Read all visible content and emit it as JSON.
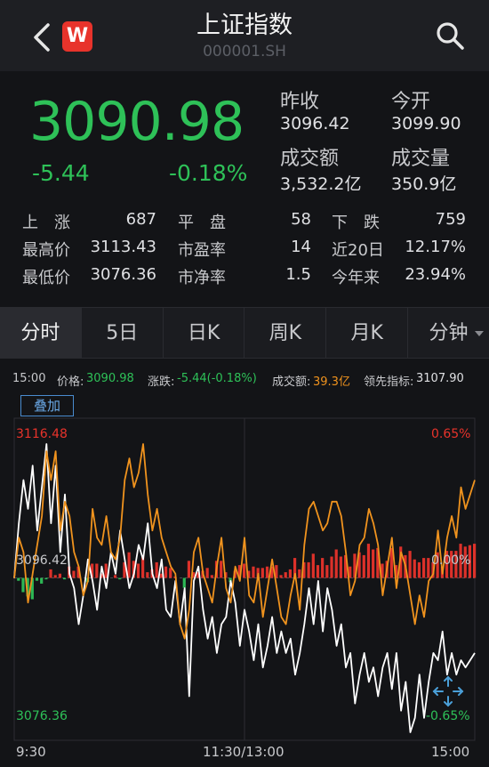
{
  "header": {
    "title": "上证指数",
    "code": "000001.SH",
    "logo_text": "W",
    "back_icon": "chevron-left-icon",
    "search_icon": "search-icon"
  },
  "quote": {
    "price": "3090.98",
    "change": "-5.44",
    "change_pct": "-0.18%",
    "prev_close_label": "昨收",
    "prev_close": "3096.42",
    "open_label": "今开",
    "open": "3099.90",
    "turnover_label": "成交额",
    "turnover": "3,532.2亿",
    "volume_label": "成交量",
    "volume": "350.9亿"
  },
  "stats": {
    "up_label": "上　涨",
    "up": "687",
    "flat_label": "平　盘",
    "flat": "58",
    "down_label": "下　跌",
    "down": "759",
    "high_label": "最高价",
    "high": "3113.43",
    "pe_label": "市盈率",
    "pe": "14",
    "d20_label": "近20日",
    "d20": "12.17%",
    "low_label": "最低价",
    "low": "3076.36",
    "pb_label": "市净率",
    "pb": "1.5",
    "ytd_label": "今年来",
    "ytd": "23.94%"
  },
  "tabs": [
    "分时",
    "5日",
    "日K",
    "周K",
    "月K",
    "分钟"
  ],
  "active_tab": "分时",
  "chart_info": {
    "time": "15:00",
    "price_label": "价格:",
    "price": "3090.98",
    "change_label": "涨跌:",
    "change": "-5.44(-0.18%)",
    "amount_label": "成交额:",
    "amount": "39.3亿",
    "lead_label": "领先指标:",
    "lead": "3107.90"
  },
  "overlay_button": "叠加",
  "colors": {
    "up": "#e8332b",
    "down": "#2ec158",
    "price_line": "#ffffff",
    "lead_line": "#f0931e",
    "accent": "#4a8ccf"
  },
  "chart_data": {
    "type": "line",
    "ylim": [
      3076.36,
      3116.48
    ],
    "pct_labels": [
      "0.65%",
      "0.00%",
      "-0.65%"
    ],
    "y_labels": [
      "3116.48",
      "3096.42",
      "3076.36"
    ],
    "x_labels": [
      "9:30",
      "11:30/13:00",
      "15:00"
    ],
    "series": [
      {
        "color": "white",
        "values": [
          3096.4,
          3104,
          3110,
          3106,
          3112,
          3103,
          3109,
          3115,
          3104,
          3112,
          3100,
          3108,
          3097,
          3095,
          3090,
          3094,
          3099,
          3096,
          3092,
          3098,
          3095,
          3100,
          3097,
          3103,
          3099,
          3095,
          3097,
          3101,
          3099,
          3104,
          3097,
          3095,
          3099,
          3092,
          3091,
          3096,
          3090,
          3095,
          3080,
          3096,
          3098,
          3092,
          3088,
          3091,
          3086,
          3090,
          3091,
          3096,
          3093,
          3087,
          3092,
          3089,
          3085,
          3090,
          3084,
          3087,
          3091,
          3086,
          3089,
          3086,
          3088,
          3083,
          3086,
          3090,
          3095,
          3090,
          3096,
          3089,
          3095,
          3092,
          3087,
          3090,
          3084,
          3086,
          3079,
          3083,
          3086,
          3082,
          3084,
          3080,
          3084,
          3086,
          3081,
          3086,
          3078,
          3082,
          3075,
          3077,
          3083,
          3077,
          3082,
          3086,
          3085,
          3089,
          3083,
          3086,
          3083,
          3085,
          3084,
          3085,
          3086
        ]
      },
      {
        "color": "orange",
        "values": [
          3096.4,
          3102,
          3100,
          3093,
          3097,
          3101,
          3105,
          3114,
          3110,
          3114,
          3103,
          3107,
          3105,
          3100,
          3098,
          3094,
          3096,
          3106,
          3102,
          3101,
          3105,
          3100,
          3099,
          3102,
          3110,
          3113,
          3109,
          3111,
          3115,
          3108,
          3103,
          3106,
          3102,
          3100,
          3098,
          3097,
          3090,
          3088,
          3092,
          3100,
          3102,
          3097,
          3095,
          3093,
          3098,
          3102,
          3095,
          3093,
          3098,
          3096,
          3102,
          3094,
          3093,
          3097,
          3091,
          3095,
          3099,
          3095,
          3091,
          3090,
          3094,
          3097,
          3092,
          3101,
          3106,
          3107,
          3105,
          3103,
          3104,
          3107,
          3107,
          3105,
          3100,
          3094,
          3096,
          3101,
          3102,
          3106,
          3104,
          3101,
          3094,
          3098,
          3102,
          3095,
          3100,
          3098,
          3094,
          3090,
          3094,
          3091,
          3096,
          3097,
          3103,
          3097,
          3102,
          3105,
          3102,
          3109,
          3106,
          3108,
          3110
        ]
      }
    ]
  }
}
